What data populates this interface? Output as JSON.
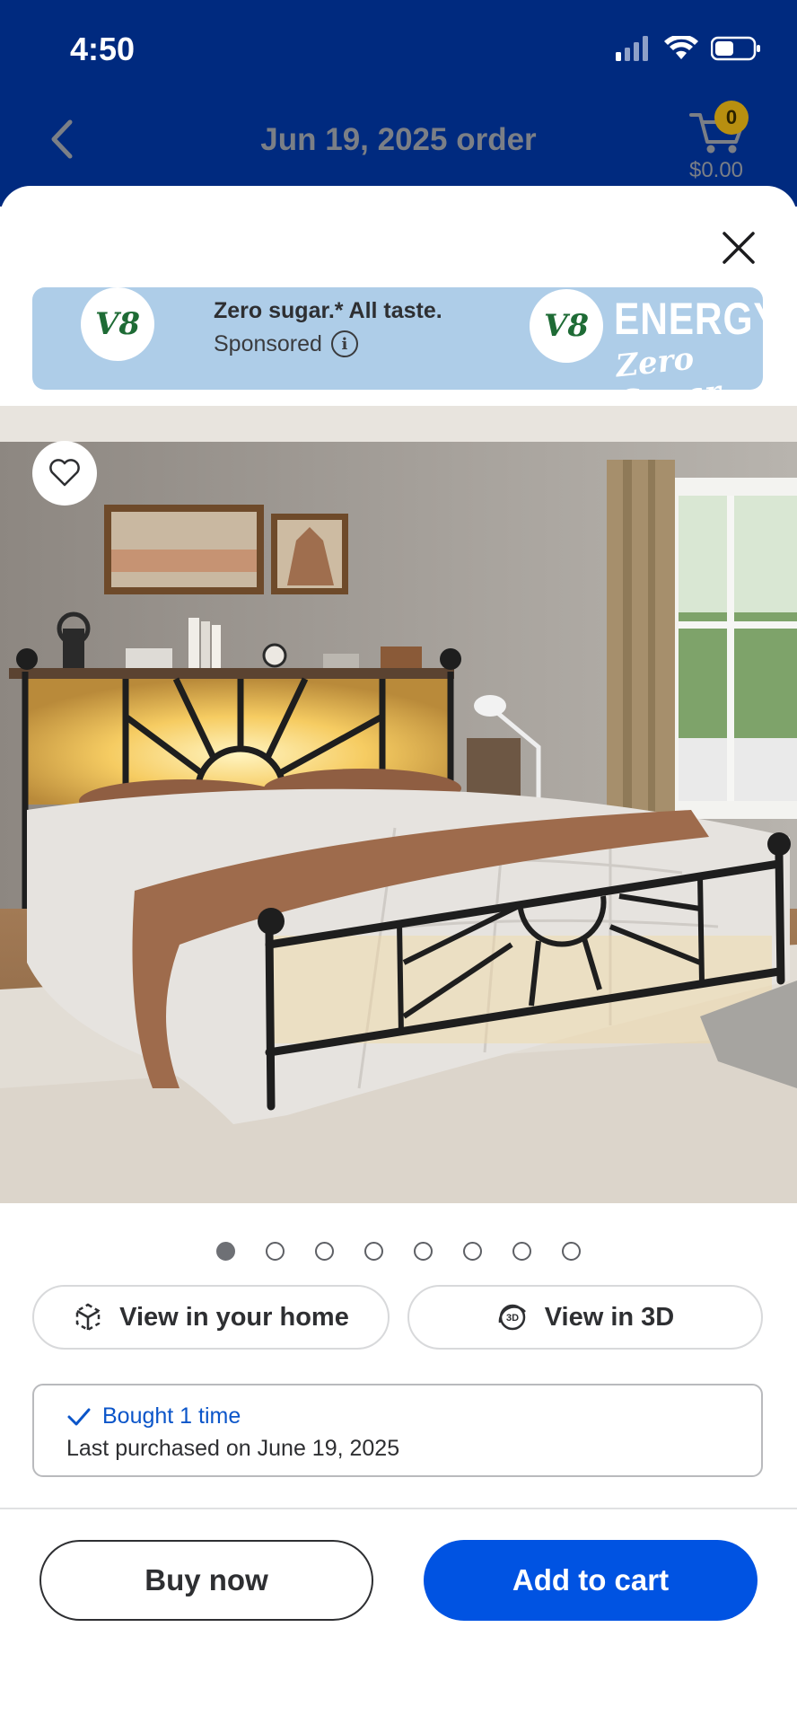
{
  "status_bar": {
    "time": "4:50"
  },
  "header": {
    "title": "Jun 19, 2025 order",
    "cart_count": "0",
    "cart_total": "$0.00"
  },
  "ad": {
    "brand_logo_text": "V8",
    "headline": "Zero sugar.* All taste.",
    "sponsored_label": "Sponsored",
    "product_text_1": "ENERGY",
    "product_text_2": "Zero Sugar"
  },
  "carousel": {
    "total_images": 8,
    "active_index": 0
  },
  "actions": {
    "view_home_label": "View in your home",
    "view_3d_label": "View in 3D"
  },
  "purchase_history": {
    "bought_label": "Bought 1 time",
    "last_purchased": "Last purchased on June 19, 2025"
  },
  "footer": {
    "buy_now_label": "Buy now",
    "add_to_cart_label": "Add to cart"
  },
  "colors": {
    "header_bg": "#002a7f",
    "primary_button": "#0053e2",
    "link_blue": "#0b55c9",
    "ad_bg": "#aecde8",
    "cart_badge": "#b88f10"
  }
}
